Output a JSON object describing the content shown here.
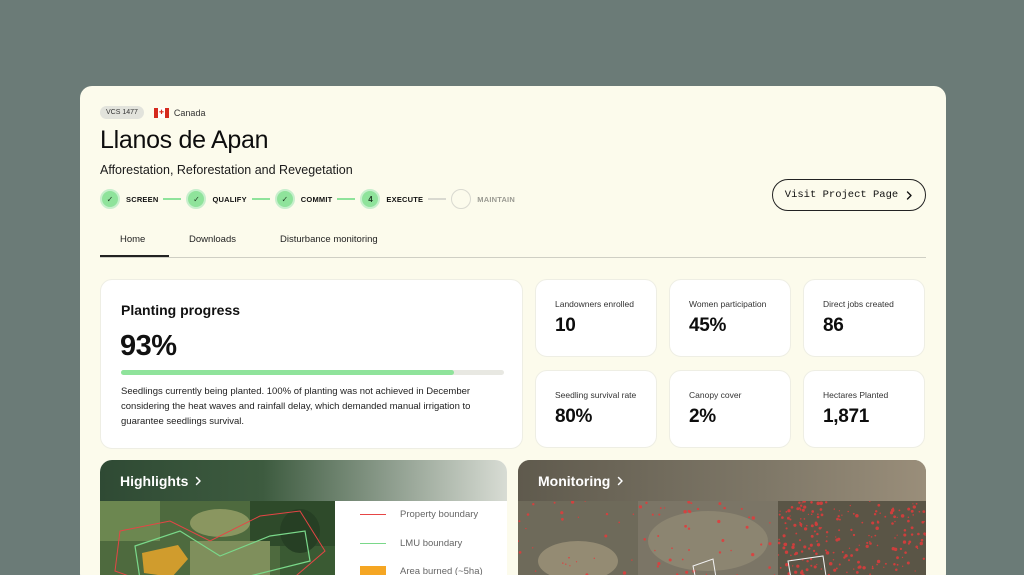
{
  "project": {
    "vcs_id": "VCS 1477",
    "country": "Canada",
    "title": "Llanos de Apan",
    "subtitle": "Afforestation, Reforestation and Revegetation"
  },
  "steps": [
    {
      "label": "SCREEN",
      "status": "done",
      "marker": "✓"
    },
    {
      "label": "QUALIFY",
      "status": "done",
      "marker": "✓"
    },
    {
      "label": "COMMIT",
      "status": "done",
      "marker": "✓"
    },
    {
      "label": "EXECUTE",
      "status": "current",
      "marker": "4"
    },
    {
      "label": "MAINTAIN",
      "status": "todo",
      "marker": ""
    }
  ],
  "visit_button": {
    "label": "Visit Project Page",
    "icon": "chevron-right-icon"
  },
  "tabs": [
    {
      "label": "Home",
      "active": true
    },
    {
      "label": "Downloads",
      "active": false
    },
    {
      "label": "Disturbance monitoring",
      "active": false
    }
  ],
  "planting": {
    "title": "Planting progress",
    "percent_label": "93%",
    "fill_fraction": 0.87,
    "description": "Seedlings currently being planted. 100% of planting was not achieved in December considering the heat waves and rainfall delay, which demanded manual irrigation to guarantee seedlings survival."
  },
  "stats": [
    {
      "label": "Landowners enrolled",
      "value": "10"
    },
    {
      "label": "Women participation",
      "value": "45%"
    },
    {
      "label": "Direct jobs created",
      "value": "86"
    },
    {
      "label": "Seedling survival rate",
      "value": "80%"
    },
    {
      "label": "Canopy cover",
      "value": "2%"
    },
    {
      "label": "Hectares Planted",
      "value": "1,871"
    }
  ],
  "highlights": {
    "title": "Highlights",
    "legend": [
      {
        "label": "Property boundary",
        "color": "#e64545",
        "kind": "line"
      },
      {
        "label": "LMU boundary",
        "color": "#7ad88a",
        "kind": "line"
      },
      {
        "label": "Area burned (~5ha)",
        "color": "#f5a623",
        "kind": "box"
      }
    ]
  },
  "monitoring": {
    "title": "Monitoring"
  },
  "colors": {
    "accent_green": "#8fe39b",
    "panel_bg": "#fcfbec",
    "page_bg": "#6b7b77"
  }
}
